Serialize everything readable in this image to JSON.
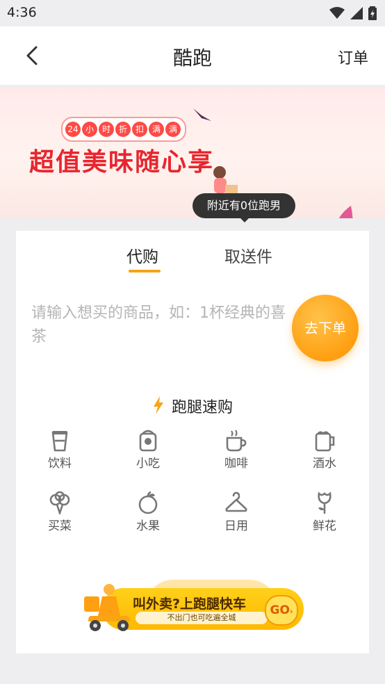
{
  "status_bar": {
    "time": "4:36"
  },
  "nav": {
    "title": "酷跑",
    "right_action": "订单"
  },
  "banner": {
    "badge_chars": [
      "24",
      "小",
      "时",
      "折",
      "扣",
      "满",
      "满"
    ],
    "slogan": "超值美味随心享"
  },
  "nearby_tip": "附近有0位跑男",
  "tabs": [
    {
      "label": "代购",
      "active": true
    },
    {
      "label": "取送件",
      "active": false
    }
  ],
  "input": {
    "placeholder": "请输入想买的商品，如：1杯经典的喜茶"
  },
  "order_button": {
    "label": "去下单"
  },
  "quick_buy": {
    "title": "跑腿速购",
    "categories": [
      {
        "label": "饮料",
        "icon": "drink-icon"
      },
      {
        "label": "小吃",
        "icon": "snack-icon"
      },
      {
        "label": "咖啡",
        "icon": "coffee-icon"
      },
      {
        "label": "酒水",
        "icon": "beer-icon"
      },
      {
        "label": "买菜",
        "icon": "vegetable-icon"
      },
      {
        "label": "水果",
        "icon": "fruit-icon"
      },
      {
        "label": "日用",
        "icon": "hanger-icon"
      },
      {
        "label": "鲜花",
        "icon": "flower-icon"
      }
    ]
  },
  "promo": {
    "headline": "叫外卖?上跑腿快车",
    "subline": "不出门也可吃遍全城",
    "go_label": "GO"
  },
  "colors": {
    "accent": "#f7a415",
    "slogan": "#e8262f",
    "icon_gray": "#777777"
  }
}
